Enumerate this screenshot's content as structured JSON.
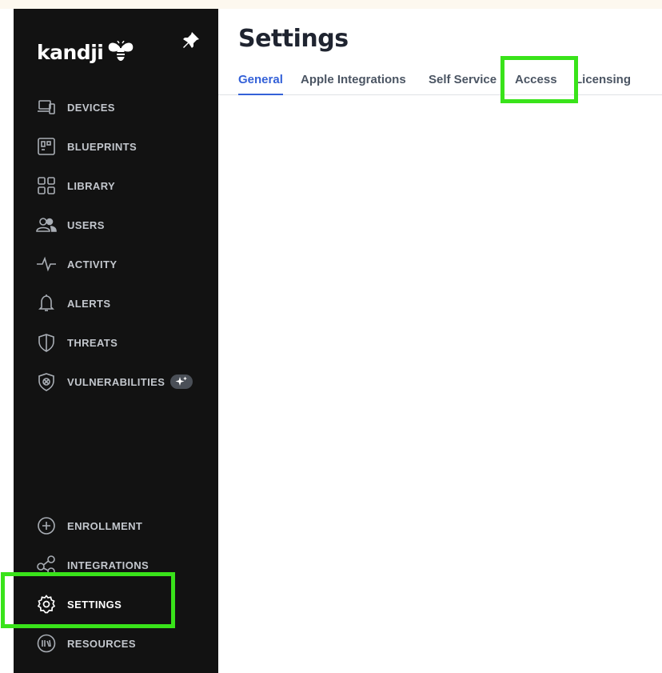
{
  "brand": {
    "logo_text": "kandji"
  },
  "sidebar": {
    "items": [
      {
        "id": "devices",
        "label": "DEVICES",
        "icon": "devices-icon"
      },
      {
        "id": "blueprints",
        "label": "BLUEPRINTS",
        "icon": "blueprint-icon"
      },
      {
        "id": "library",
        "label": "LIBRARY",
        "icon": "grid-icon"
      },
      {
        "id": "users",
        "label": "USERS",
        "icon": "users-icon"
      },
      {
        "id": "activity",
        "label": "ACTIVITY",
        "icon": "pulse-icon"
      },
      {
        "id": "alerts",
        "label": "ALERTS",
        "icon": "bell-icon"
      },
      {
        "id": "threats",
        "label": "THREATS",
        "icon": "shield-icon"
      },
      {
        "id": "vulnerabilities",
        "label": "VULNERABILITIES",
        "icon": "shield-bug-icon",
        "badge_icon": "sparkle-icon"
      }
    ],
    "bottom_items": [
      {
        "id": "enrollment",
        "label": "ENROLLMENT",
        "icon": "plus-circle-icon"
      },
      {
        "id": "integrations",
        "label": "INTEGRATIONS",
        "icon": "share-nodes-icon"
      },
      {
        "id": "settings",
        "label": "SETTINGS",
        "icon": "gear-icon",
        "active": true
      },
      {
        "id": "resources",
        "label": "RESOURCES",
        "icon": "books-icon"
      }
    ]
  },
  "main": {
    "title": "Settings",
    "tabs": [
      {
        "label": "General",
        "active": true
      },
      {
        "label": "Apple Integrations"
      },
      {
        "label": "Self Service"
      },
      {
        "label": "Access"
      },
      {
        "label": "Licensing"
      }
    ]
  },
  "colors": {
    "sidebar_bg": "#121212",
    "accent_blue": "#3461d8",
    "highlight_green": "#39e31a"
  }
}
